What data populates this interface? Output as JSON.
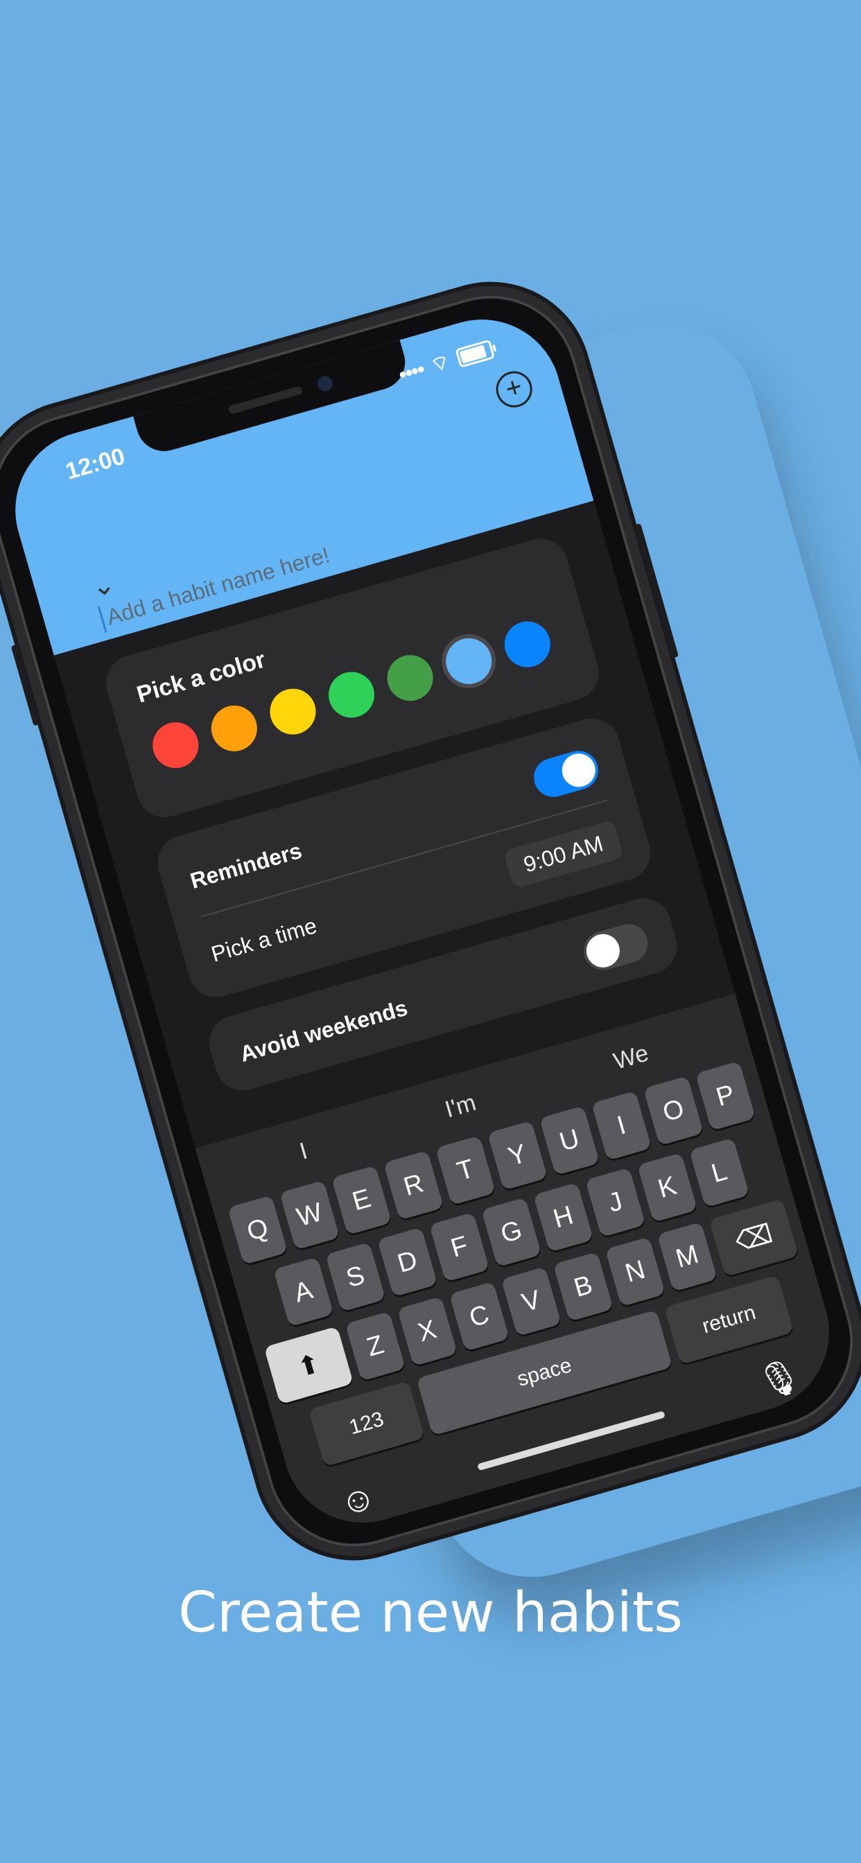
{
  "status": {
    "time": "12:00"
  },
  "header": {
    "placeholder": "Add a habit name here!",
    "add_icon": "+",
    "collapse_icon": "⌄"
  },
  "color_picker": {
    "title": "Pick a color",
    "colors": [
      "#ff453a",
      "#ff9f0a",
      "#ffd60a",
      "#30d158",
      "#43a047",
      "#64b5f6",
      "#0a84ff"
    ],
    "selected_index": 5
  },
  "reminders": {
    "title": "Reminders",
    "enabled": true,
    "pick_time_label": "Pick a time",
    "time": "9:00 AM",
    "pick_time_enabled": false
  },
  "avoid_weekends": {
    "label": "Avoid weekends"
  },
  "keyboard": {
    "suggestions": [
      "I",
      "I'm",
      "We"
    ],
    "row1": [
      "Q",
      "W",
      "E",
      "R",
      "T",
      "Y",
      "U",
      "I",
      "O",
      "P"
    ],
    "row2": [
      "A",
      "S",
      "D",
      "F",
      "G",
      "H",
      "J",
      "K",
      "L"
    ],
    "row3": [
      "Z",
      "X",
      "C",
      "V",
      "B",
      "N",
      "M"
    ],
    "shift": "⬆",
    "delete": "⌫",
    "numbers": "123",
    "space": "space",
    "return": "return",
    "emoji": "☺",
    "mic": "🎙"
  },
  "caption": "Create new habits"
}
